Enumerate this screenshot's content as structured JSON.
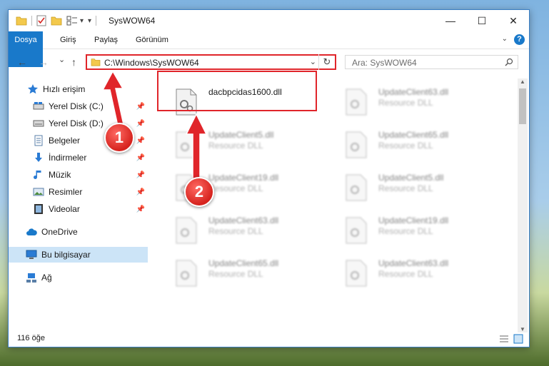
{
  "window": {
    "title": "SysWOW64",
    "minimize_label": "—",
    "maximize_label": "☐",
    "close_label": "✕"
  },
  "ribbon": {
    "tabs": [
      {
        "label": "Dosya",
        "active": true
      },
      {
        "label": "Giriş"
      },
      {
        "label": "Paylaş"
      },
      {
        "label": "Görünüm"
      }
    ],
    "help_label": "?"
  },
  "nav": {
    "back_label": "←",
    "forward_label": "→",
    "recent_label": "⌄",
    "up_label": "↑",
    "address": "C:\\Windows\\SysWOW64",
    "search_placeholder": "Ara: SysWOW64"
  },
  "sidebar": {
    "quick_access": "Hızlı erişim",
    "items": [
      {
        "label": "Yerel Disk (C:)",
        "icon": "drive-icon",
        "pinned": true
      },
      {
        "label": "Yerel Disk (D:)",
        "icon": "drive-icon",
        "pinned": true
      },
      {
        "label": "Belgeler",
        "icon": "documents-icon",
        "pinned": true
      },
      {
        "label": "İndirmeler",
        "icon": "downloads-icon",
        "pinned": true
      },
      {
        "label": "Müzik",
        "icon": "music-icon",
        "pinned": true
      },
      {
        "label": "Resimler",
        "icon": "pictures-icon",
        "pinned": true
      },
      {
        "label": "Videolar",
        "icon": "videos-icon",
        "pinned": true
      }
    ],
    "onedrive": "OneDrive",
    "this_pc": "Bu bilgisayar",
    "network": "Ağ"
  },
  "files": [
    {
      "name": "dacbpcidas1600.dll",
      "desc": "",
      "focused": true
    },
    {
      "name": "UpdateClient63.dll",
      "desc": "Resource DLL"
    },
    {
      "name": "UpdateClient5.dll",
      "desc": "Resource DLL"
    },
    {
      "name": "UpdateClient65.dll",
      "desc": "Resource DLL"
    },
    {
      "name": "UpdateClient19.dll",
      "desc": "Resource DLL"
    },
    {
      "name": "UpdateClient5.dll",
      "desc": "Resource DLL"
    },
    {
      "name": "UpdateClient63.dll",
      "desc": "Resource DLL"
    },
    {
      "name": "UpdateClient19.dll",
      "desc": "Resource DLL"
    },
    {
      "name": "UpdateClient65.dll",
      "desc": "Resource DLL"
    },
    {
      "name": "UpdateClient63.dll",
      "desc": "Resource DLL"
    }
  ],
  "status": {
    "count": "116 öğe"
  },
  "annotations": {
    "badge1": "1",
    "badge2": "2"
  },
  "colors": {
    "accent": "#1979ca",
    "highlight": "#e0252a",
    "selected": "#cce4f7"
  }
}
